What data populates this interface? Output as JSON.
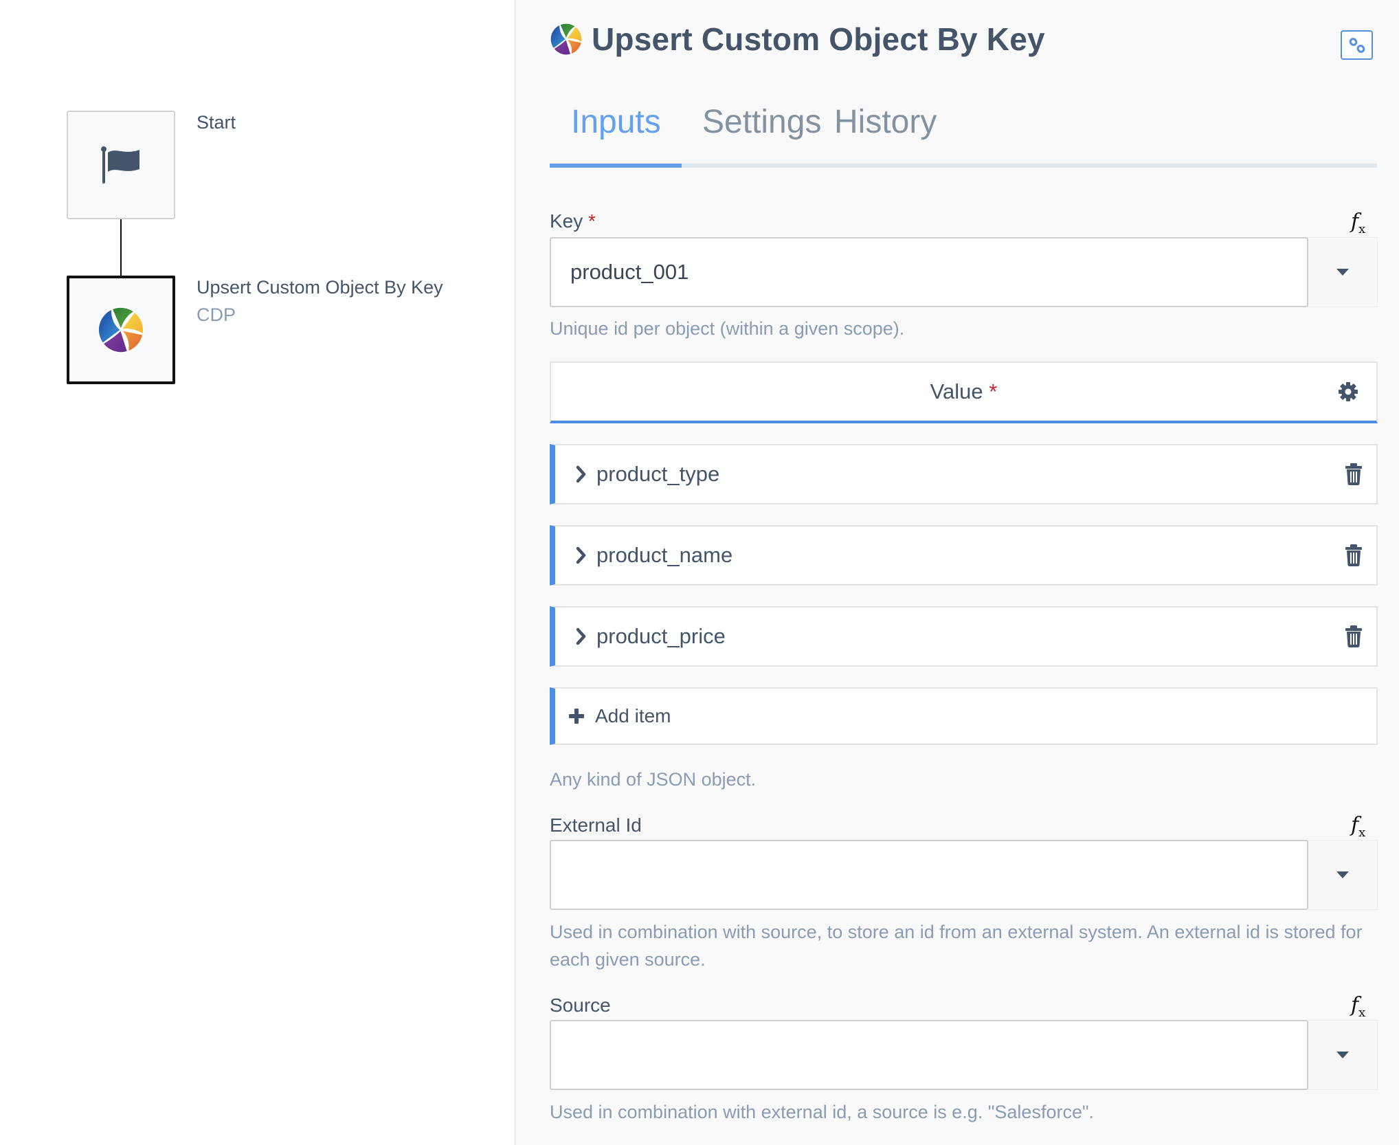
{
  "canvas": {
    "nodes": [
      {
        "label": "Start",
        "icon": "flag-icon"
      },
      {
        "label": "Upsert Custom Object By Key",
        "sublabel": "CDP",
        "icon": "cdp-logo-icon",
        "selected": true
      }
    ]
  },
  "panel": {
    "title": "Upsert Custom Object By Key",
    "title_icon": "cdp-logo-icon",
    "link_button_icon": "link-icon",
    "tabs": [
      {
        "label": "Inputs",
        "active": true
      },
      {
        "label": "Settings",
        "active": false
      },
      {
        "label": "History",
        "active": false
      }
    ],
    "fields": {
      "key": {
        "label": "Key",
        "required_mark": "*",
        "fx_label": "fx",
        "value": "product_001",
        "help": "Unique id per object (within a given scope)."
      },
      "value": {
        "label": "Value",
        "required_mark": "*",
        "items": [
          {
            "label": "product_type"
          },
          {
            "label": "product_name"
          },
          {
            "label": "product_price"
          }
        ],
        "add_label": "Add item",
        "help": "Any kind of JSON object."
      },
      "external_id": {
        "label": "External Id",
        "fx_label": "fx",
        "value": "",
        "help": "Used in combination with source, to store an id from an external system. An external id is stored for each given source."
      },
      "source": {
        "label": "Source",
        "fx_label": "fx",
        "value": "",
        "help": "Used in combination with external id, a source is e.g. \"Salesforce\"."
      }
    }
  },
  "colors": {
    "accent": "#64a0f0",
    "item_bar": "#4a8fe4",
    "required": "#c0262d",
    "text": "#44546b",
    "help_text": "#8a9bb5"
  }
}
